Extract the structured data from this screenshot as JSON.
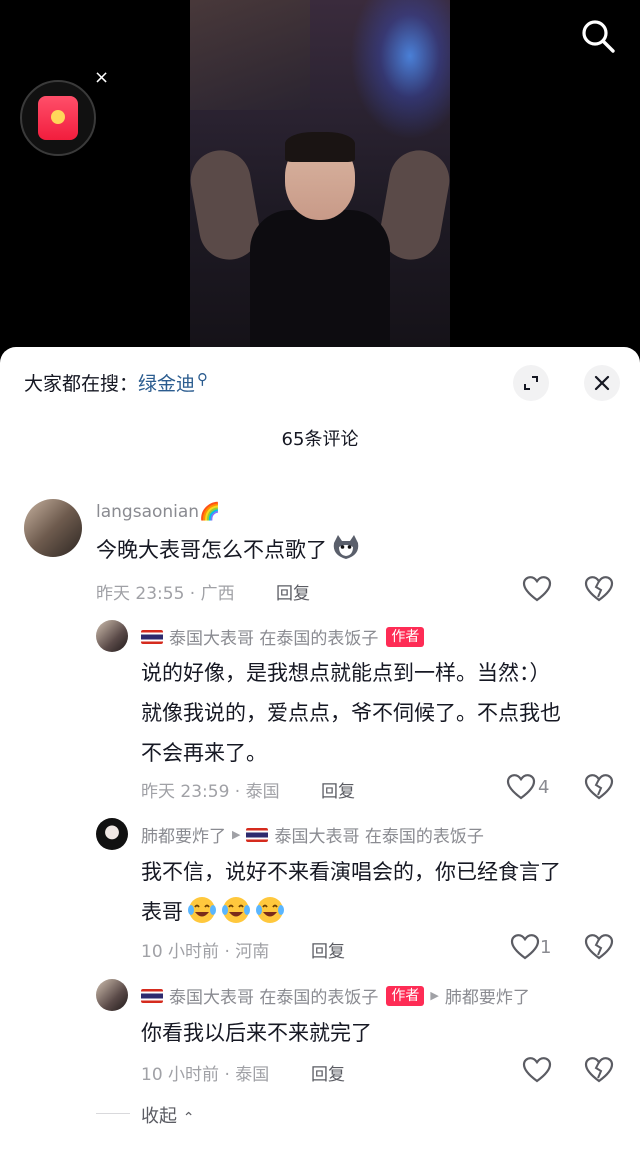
{
  "video": {
    "close_mark": "×"
  },
  "sheet": {
    "hot_search_prefix": "大家都在搜：",
    "hot_search_term": "绿金迪",
    "comment_count": "65条评论",
    "collapse_label": "收起"
  },
  "comments": [
    {
      "username": "langsaonian🌈",
      "text": "今晚大表哥怎么不点歌了",
      "time": "昨天 23:55 · 广西",
      "reply": "回复",
      "likes": ""
    },
    {
      "username": "泰国大表哥 在泰国的表饭子",
      "author_tag": "作者",
      "text_lines": [
        "说的好像，是我想点就能点到一样。当然：）",
        "就像我说的，爱点点，爷不伺候了。不点我也",
        "不会再来了。"
      ],
      "time": "昨天 23:59 · 泰国",
      "reply": "回复",
      "likes": "4"
    },
    {
      "username": "肺都要炸了",
      "reply_to": "泰国大表哥 在泰国的表饭子",
      "text_lines": [
        "我不信，说好不来看演唱会的，你已经食言了",
        "表哥"
      ],
      "time": "10 小时前 · 河南",
      "reply": "回复",
      "likes": "1"
    },
    {
      "username": "泰国大表哥 在泰国的表饭子",
      "author_tag": "作者",
      "reply_to": "肺都要炸了",
      "text": "你看我以后来不来就完了",
      "time": "10 小时前 · 泰国",
      "reply": "回复",
      "likes": ""
    }
  ],
  "icons": [
    "search-icon",
    "red-packet-icon",
    "close-icon",
    "expand-icon",
    "heart-icon",
    "broken-heart-icon",
    "laugh-cry-emoji",
    "cat-emoji",
    "chevron-up-icon"
  ]
}
